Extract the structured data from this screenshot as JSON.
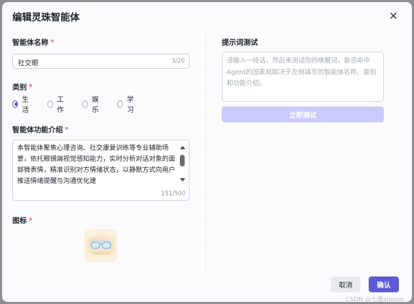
{
  "dialog": {
    "title": "编辑灵珠智能体",
    "close_symbol": "×",
    "required_mark": "*"
  },
  "name_field": {
    "label": "智能体名称",
    "value": "社交眼",
    "counter": "3/20"
  },
  "category": {
    "label": "类别",
    "options": [
      "生活",
      "工作",
      "娱乐",
      "学习"
    ],
    "selected": "生活"
  },
  "description": {
    "label": "智能体功能介绍",
    "value": "本智能体聚焦心理咨询、社交康复训练等专业辅助场景，依托眼镜端视觉感知能力，实时分析对话对象的面部微表情，精准识别对方情绪状态，以静默方式向用户推送情绪提醒与沟通优化建",
    "counter": "151/500"
  },
  "icon_field": {
    "label": "图标",
    "icon": "glasses-icon"
  },
  "prompt_test": {
    "title": "提示词测试",
    "placeholder": "请输入一段话，然后来测试你的唤醒词，能否命中Agent的因素就取决于左侧填写的智能体名称、类别和功能介绍。",
    "button": "立即测试"
  },
  "footer": {
    "cancel": "取消",
    "confirm": "确认"
  },
  "watermark": "CSDN @七夜zippoe",
  "colors": {
    "primary": "#5b5bd6",
    "primary_disabled": "#c9cbfa",
    "required": "#e02e2e"
  }
}
